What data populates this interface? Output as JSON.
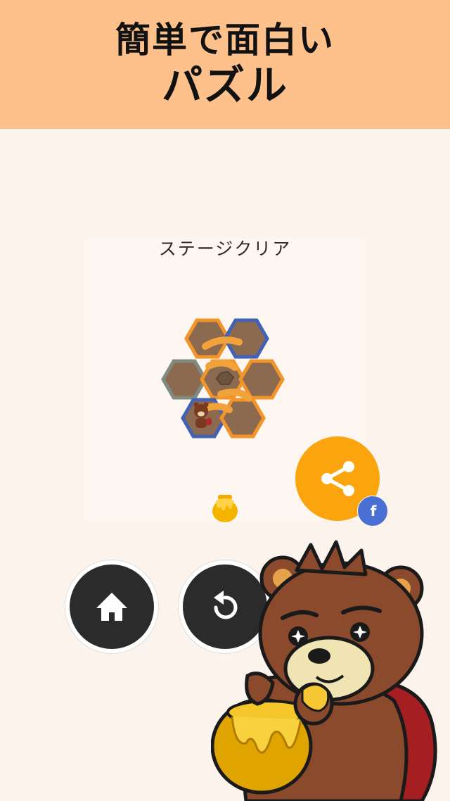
{
  "promo": {
    "line1": "簡単で面白い",
    "line2": "パズル"
  },
  "result": {
    "title": "ステージクリア"
  },
  "buttons": {
    "share_icon": "share-icon",
    "facebook_label": "f",
    "home_icon": "home-icon",
    "restart_icon": "restart-icon"
  },
  "colors": {
    "banner": "#fec18b",
    "background": "#fcf3ec",
    "share": "#fca40d",
    "facebook": "#4a6fd4",
    "round_button": "#2b2b2b"
  }
}
